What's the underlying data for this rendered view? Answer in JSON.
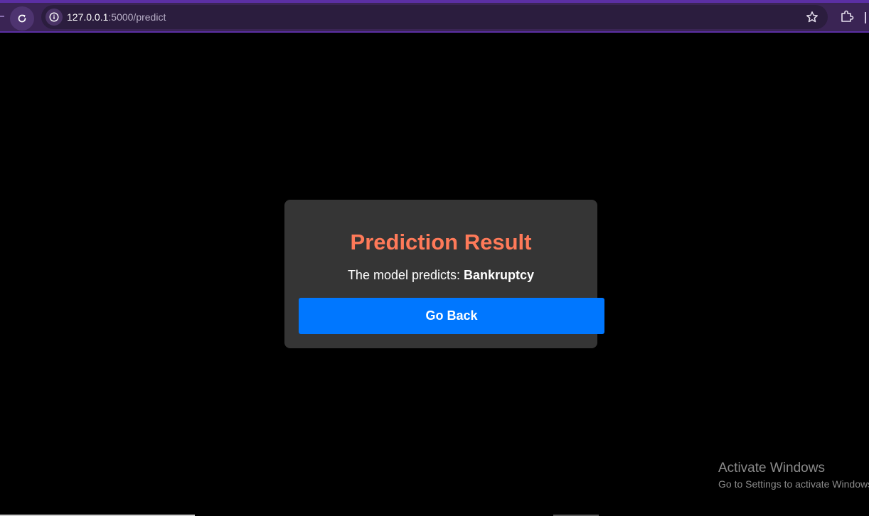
{
  "browser": {
    "url_host": "127.0.0.1",
    "url_path": ":5000/predict"
  },
  "card": {
    "title": "Prediction Result",
    "result_prefix": "The model predicts: ",
    "result_value": "Bankruptcy",
    "back_button_label": "Go Back"
  },
  "watermark": {
    "title": "Activate Windows",
    "subtitle": "Go to Settings to activate Windows."
  },
  "colors": {
    "page_background": "#000000",
    "card_background": "#353535",
    "title": "#ff7a59",
    "button": "#0077ff",
    "browser_bar": "#3a2454"
  },
  "icons": {
    "reload": "reload-icon",
    "site_info": "info-icon",
    "bookmark": "star-icon",
    "extensions": "puzzle-icon"
  }
}
